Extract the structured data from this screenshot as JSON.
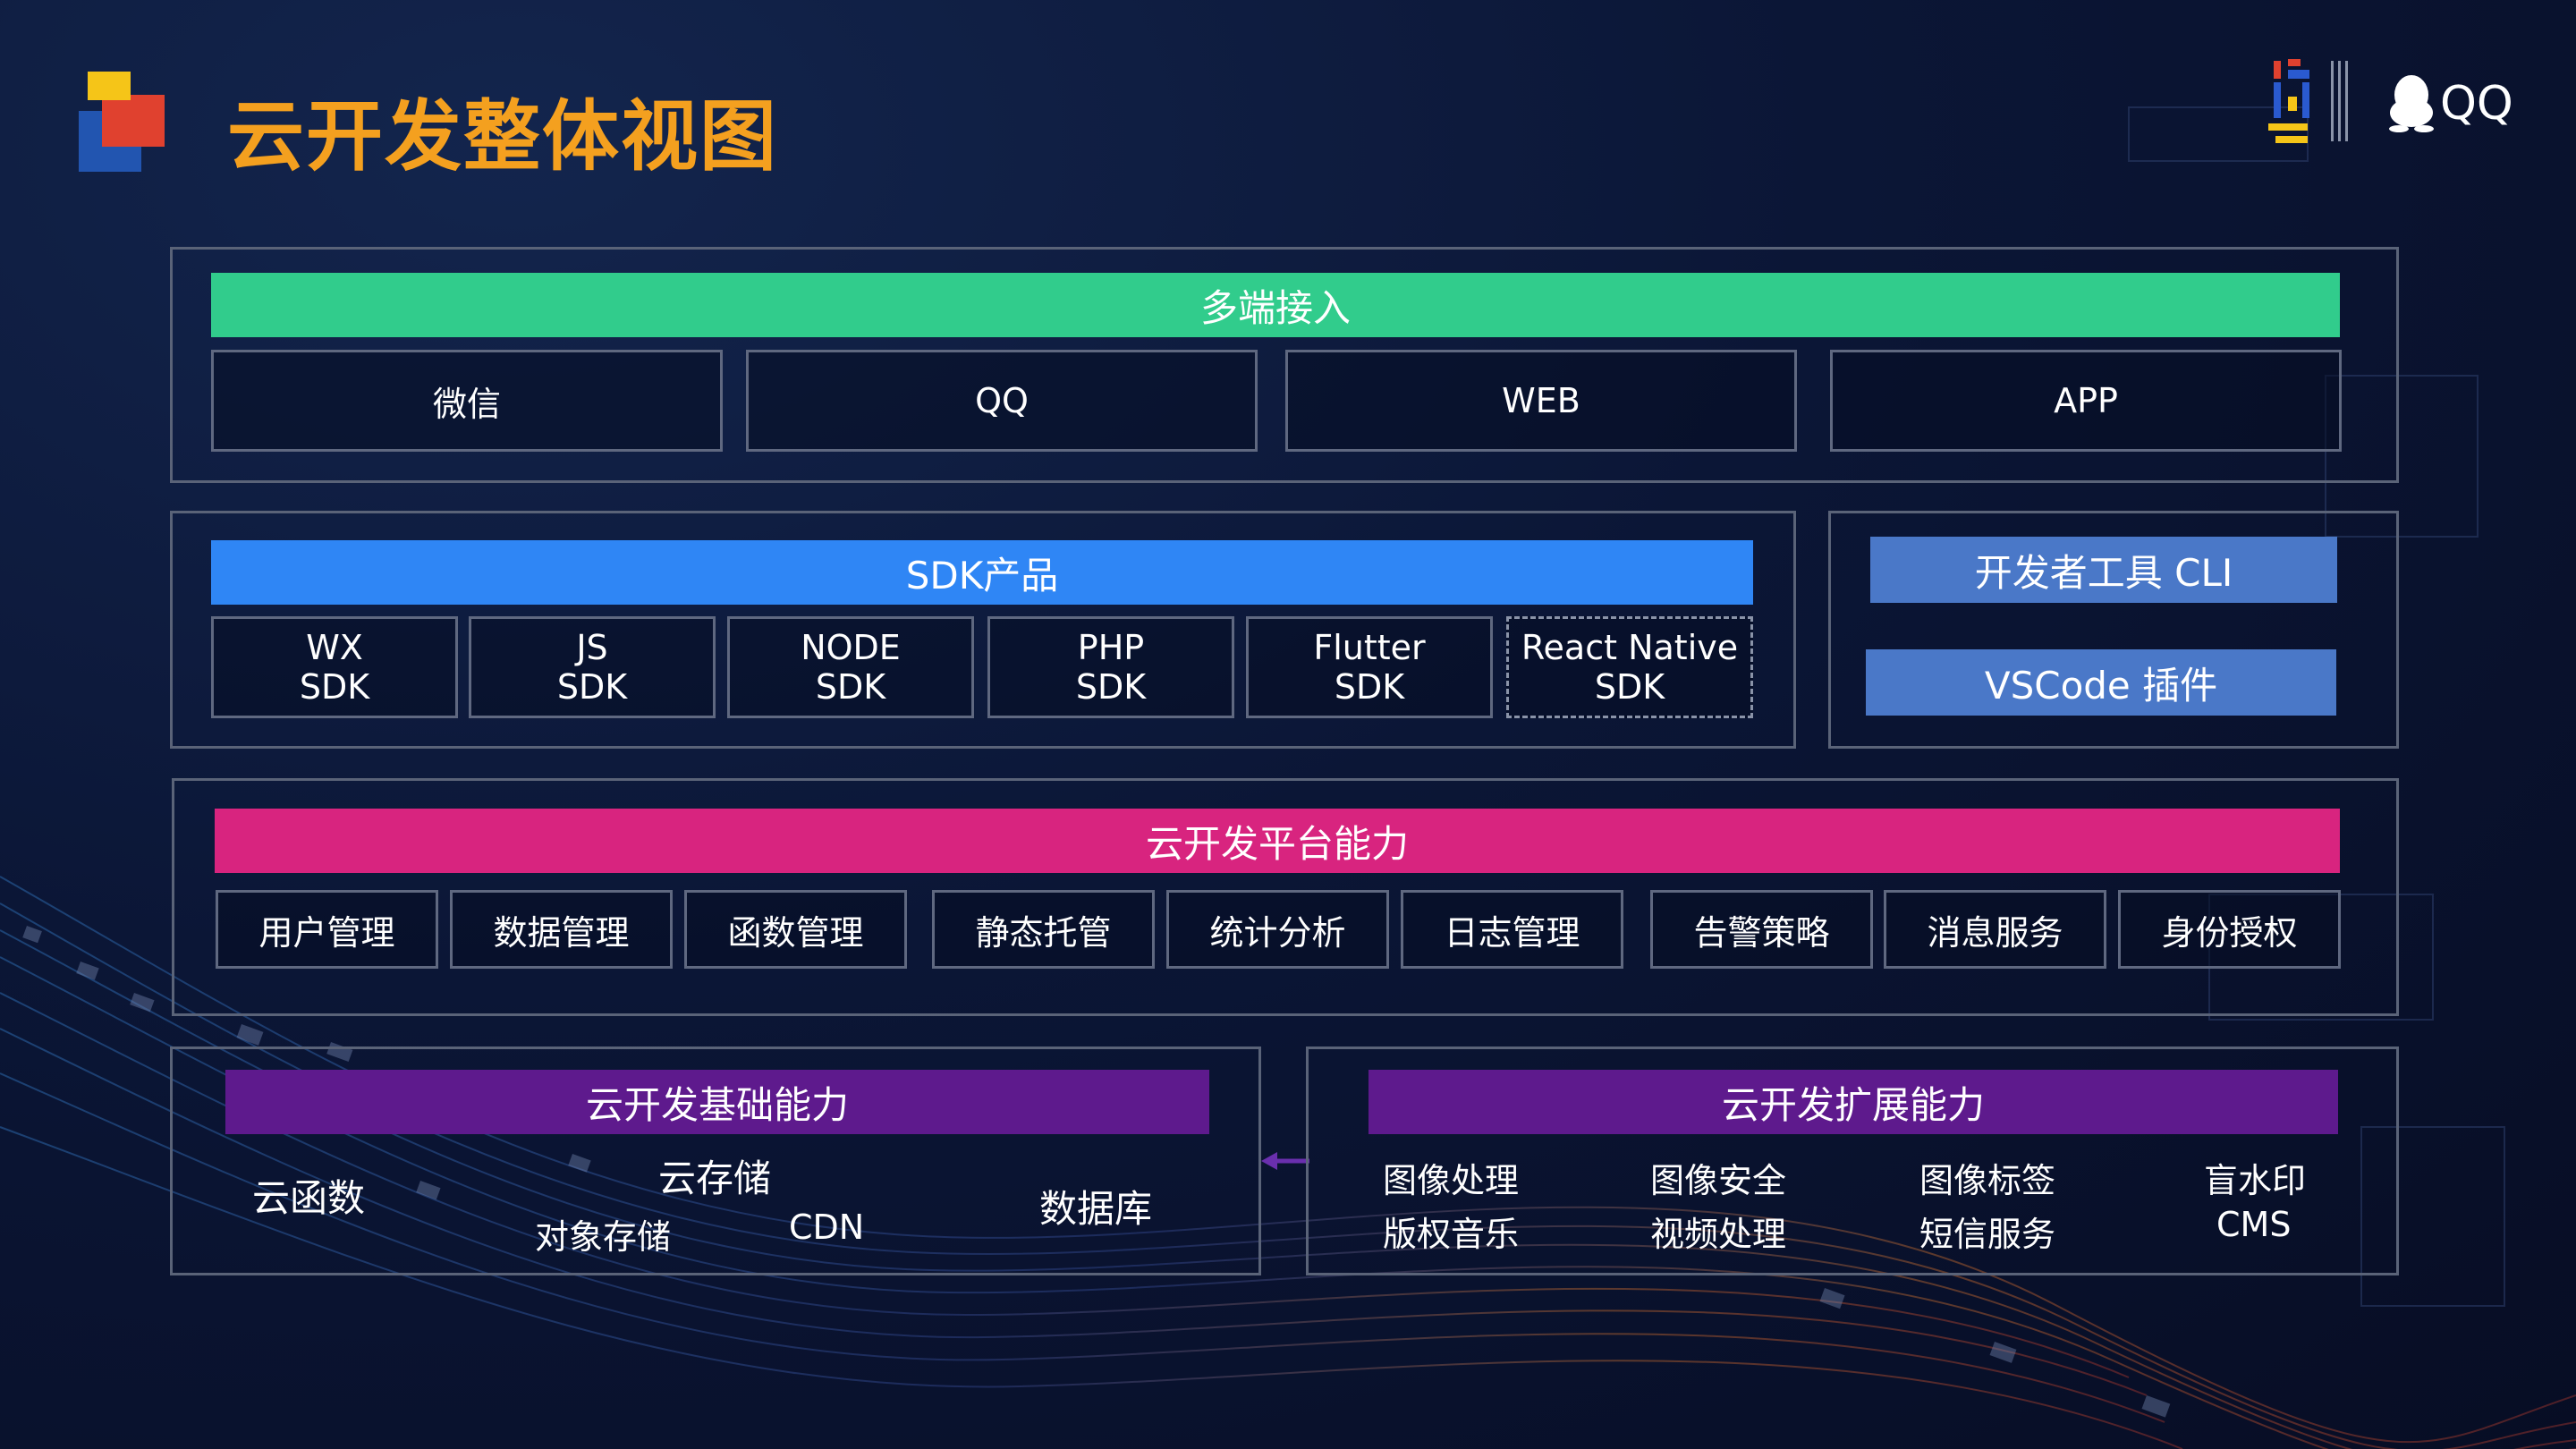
{
  "title": "云开发整体视图",
  "brand": {
    "qq": "QQ"
  },
  "colors": {
    "title": "#f4a01f",
    "green": "#31cc8c",
    "blue": "#2f86f5",
    "steel": "#4a78c8",
    "magenta": "#d8247f",
    "purple": "#5e1a8d"
  },
  "access": {
    "header": "多端接入",
    "items": [
      "微信",
      "QQ",
      "WEB",
      "APP"
    ]
  },
  "sdk": {
    "header": "SDK产品",
    "items": [
      {
        "name": "WX",
        "suffix": "SDK"
      },
      {
        "name": "JS",
        "suffix": "SDK"
      },
      {
        "name": "NODE",
        "suffix": "SDK"
      },
      {
        "name": "PHP",
        "suffix": "SDK"
      },
      {
        "name": "Flutter",
        "suffix": "SDK"
      },
      {
        "name": "React Native",
        "suffix": "SDK"
      }
    ]
  },
  "tools": {
    "cli": "开发者工具 CLI",
    "vscode": "VSCode 插件"
  },
  "platform": {
    "header": "云开发平台能力",
    "items": [
      "用户管理",
      "数据管理",
      "函数管理",
      "静态托管",
      "统计分析",
      "日志管理",
      "告警策略",
      "消息服务",
      "身份授权"
    ]
  },
  "basic": {
    "header": "云开发基础能力",
    "functions": "云函数",
    "storage": "云存储",
    "object_storage": "对象存储",
    "cdn": "CDN",
    "database": "数据库"
  },
  "extend": {
    "header": "云开发扩展能力",
    "items": [
      "图像处理",
      "图像安全",
      "图像标签",
      "盲水印",
      "版权音乐",
      "视频处理",
      "短信服务",
      "CMS"
    ]
  }
}
